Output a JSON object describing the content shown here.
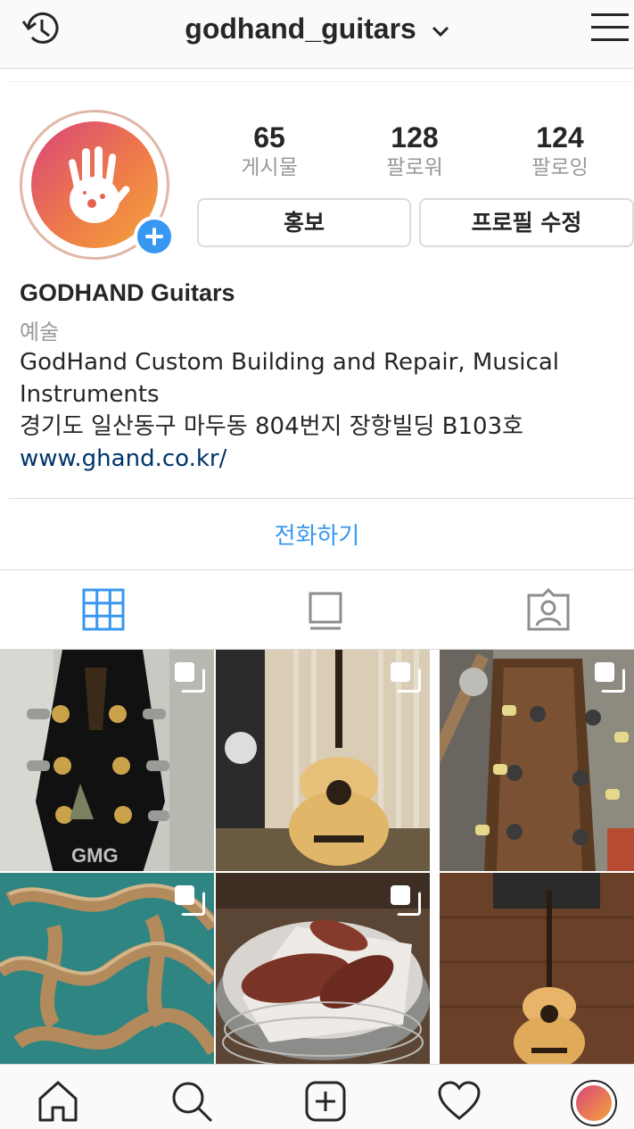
{
  "header": {
    "username": "godhand_guitars",
    "icons": {
      "left": "history-icon",
      "right": "hamburger-menu-icon",
      "dropdown": "chevron-down-icon"
    }
  },
  "profile": {
    "stats": [
      {
        "value": "65",
        "label": "게시물"
      },
      {
        "value": "128",
        "label": "팔로워"
      },
      {
        "value": "124",
        "label": "팔로잉"
      }
    ],
    "promote_label": "홍보",
    "edit_profile_label": "프로필 수정",
    "display_name": "GODHAND Guitars",
    "category": "예술",
    "bio_line1": "GodHand Custom Building and Repair, Musical",
    "bio_line2": "Instruments",
    "address": "경기도 일산동구 마두동 804번지 장항빌딩 B103호",
    "website": "www.ghand.co.kr/",
    "call_label": "전화하기",
    "accent": "#3897f0"
  },
  "tabs": [
    "grid-view-icon",
    "feed-view-icon",
    "tagged-photos-icon"
  ],
  "posts": [
    {
      "subject": "guitar-headstock-black",
      "multiple": true
    },
    {
      "subject": "acoustic-guitar-shop",
      "multiple": true
    },
    {
      "subject": "guitar-headstock-wood",
      "multiple": true
    },
    {
      "subject": "guitar-side-molds",
      "multiple": true
    },
    {
      "subject": "roasted-sweet-potatoes",
      "multiple": true
    },
    {
      "subject": "acoustic-guitar-wall",
      "multiple": true
    }
  ],
  "bottom_nav": [
    "home-icon",
    "search-icon",
    "new-post-icon",
    "activity-heart-icon",
    "profile-avatar"
  ]
}
